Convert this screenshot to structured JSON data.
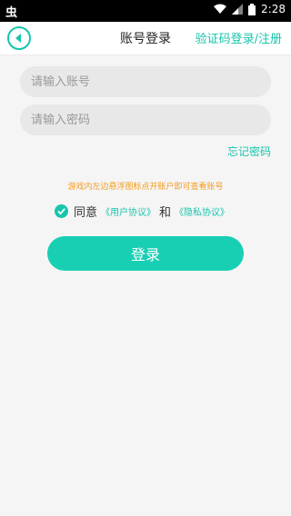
{
  "status_bar": {
    "left_icon": "bug-icon",
    "time": "2:28",
    "icons": [
      "wifi-icon",
      "signal-icon",
      "battery-icon"
    ]
  },
  "header": {
    "title": "账号登录",
    "switch_link": "验证码登录/注册",
    "back_icon": "back-arrow-icon"
  },
  "form": {
    "account_placeholder": "请输入账号",
    "password_placeholder": "请输入密码",
    "forgot_password": "忘记密码",
    "hint": "游戏内左边悬浮图标点开账户即可查看账号",
    "agree_text": "同意",
    "user_agreement": "《用户协议》",
    "and_text": "和",
    "privacy_policy": "《隐私协议》",
    "login_button": "登录"
  },
  "colors": {
    "accent": "#17c5ad",
    "hint": "#f59c1a",
    "button": "#18cfb3"
  }
}
